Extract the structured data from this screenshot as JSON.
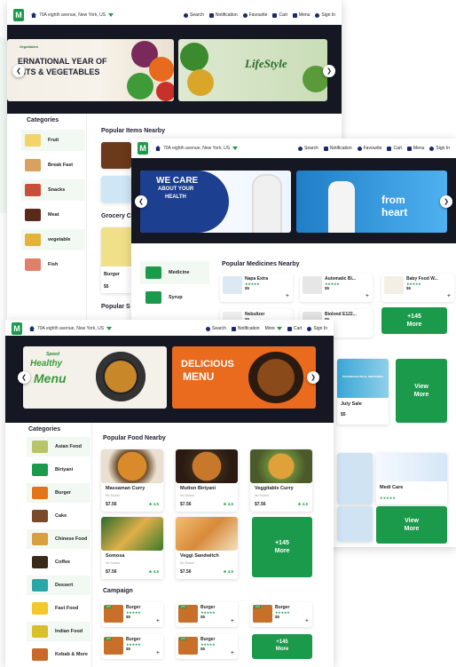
{
  "colors": {
    "brand": "#1b9a4b",
    "dark": "#151723",
    "nav_icon": "#1a2a6c"
  },
  "logo": "M",
  "p1": {
    "location": "70A eighth avenue, New York, US",
    "nav": [
      "Search",
      "Notification",
      "Favourite",
      "Cart",
      "Menu",
      "Sign In"
    ],
    "banner1_brand": "Vegetables",
    "banner1_line1": "ERNATIONAL YEAR OF",
    "banner1_line2": "UITS & VEGETABLES",
    "banner2_title": "LifeStyle",
    "categories_title": "Categories",
    "categories": [
      "Fruit",
      "Break Fast",
      "Snacks",
      "Meat",
      "vegetable",
      "Fish"
    ],
    "popular_title": "Popular Items Nearby",
    "grocery_title": "Grocery C",
    "burger_name": "Burger",
    "burger_price": "$5",
    "popular_s": "Popular S"
  },
  "p2": {
    "location": "70A eighth avenue, New York, US",
    "nav": [
      "Search",
      "Notification",
      "Favourite",
      "Cart",
      "Menu",
      "Sign In"
    ],
    "banner1_line1": "WE CARE",
    "banner1_line2": "ABOUT YOUR",
    "banner1_line3": "HEALTH",
    "banner2_line1": "from",
    "banner2_line2": "heart",
    "categories": [
      "Medicine",
      "Syrup"
    ],
    "popular_title": "Popular Medicines Nearby",
    "medicines": [
      {
        "name": "Napa Extra",
        "price": "$5"
      },
      {
        "name": "Automatic Bl...",
        "price": "$5"
      },
      {
        "name": "Baby Food W...",
        "price": "$5"
      },
      {
        "name": "Nebulizer",
        "price": "$5"
      },
      {
        "name": "Biolond E122...",
        "price": "$5"
      }
    ],
    "more": [
      "+145",
      "More"
    ],
    "view_more": [
      "View",
      "More"
    ],
    "july_sale": "July Sale",
    "july_price": "$5",
    "pharma_banner": "PHARMACEUTICAL MEDICINES",
    "medi_care": "Medi Care",
    "view_more2": [
      "View",
      "More"
    ]
  },
  "p3": {
    "location": "70A eighth avenue, New York, US",
    "nav": [
      "Search",
      "Notification",
      "More",
      "Cart",
      "Sign In"
    ],
    "banner1_line1": "Speed",
    "banner1_line2": "Healthy",
    "banner1_line3": "Menu",
    "banner2_line1": "DELICIOUS",
    "banner2_line2": "MENU",
    "categories_title": "Categories",
    "categories": [
      "Asian Food",
      "Biriyani",
      "Burger",
      "Cake",
      "Chinese Food",
      "Coffee",
      "Dessert",
      "Fast Food",
      "Indian Food",
      "Kebab & More"
    ],
    "popular_title": "Popular Food Nearby",
    "foods": [
      {
        "name": "Massaman Curry",
        "sub": "No Sound",
        "price": "$7.56",
        "rating": "4.5"
      },
      {
        "name": "Mutton Biriyani",
        "sub": "No Sound",
        "price": "$7.56",
        "rating": "4.5"
      },
      {
        "name": "Veggitable Curry",
        "sub": "No Sound",
        "price": "$7.56",
        "rating": "4.5"
      },
      {
        "name": "Somosa",
        "sub": "No Sound",
        "price": "$7.56",
        "rating": "4.5"
      },
      {
        "name": "Veggi Sandwitch",
        "sub": "No Sound",
        "price": "$7.56",
        "rating": "4.5"
      }
    ],
    "more": [
      "+145",
      "More"
    ],
    "campaign_title": "Campaign",
    "campaign": [
      {
        "name": "Burger",
        "price": "$5"
      },
      {
        "name": "Burger",
        "price": "$5"
      },
      {
        "name": "Burger",
        "price": "$5"
      },
      {
        "name": "Burger",
        "price": "$5"
      },
      {
        "name": "Burger",
        "price": "$5"
      }
    ],
    "campaign_more": [
      "+145",
      "More"
    ]
  }
}
